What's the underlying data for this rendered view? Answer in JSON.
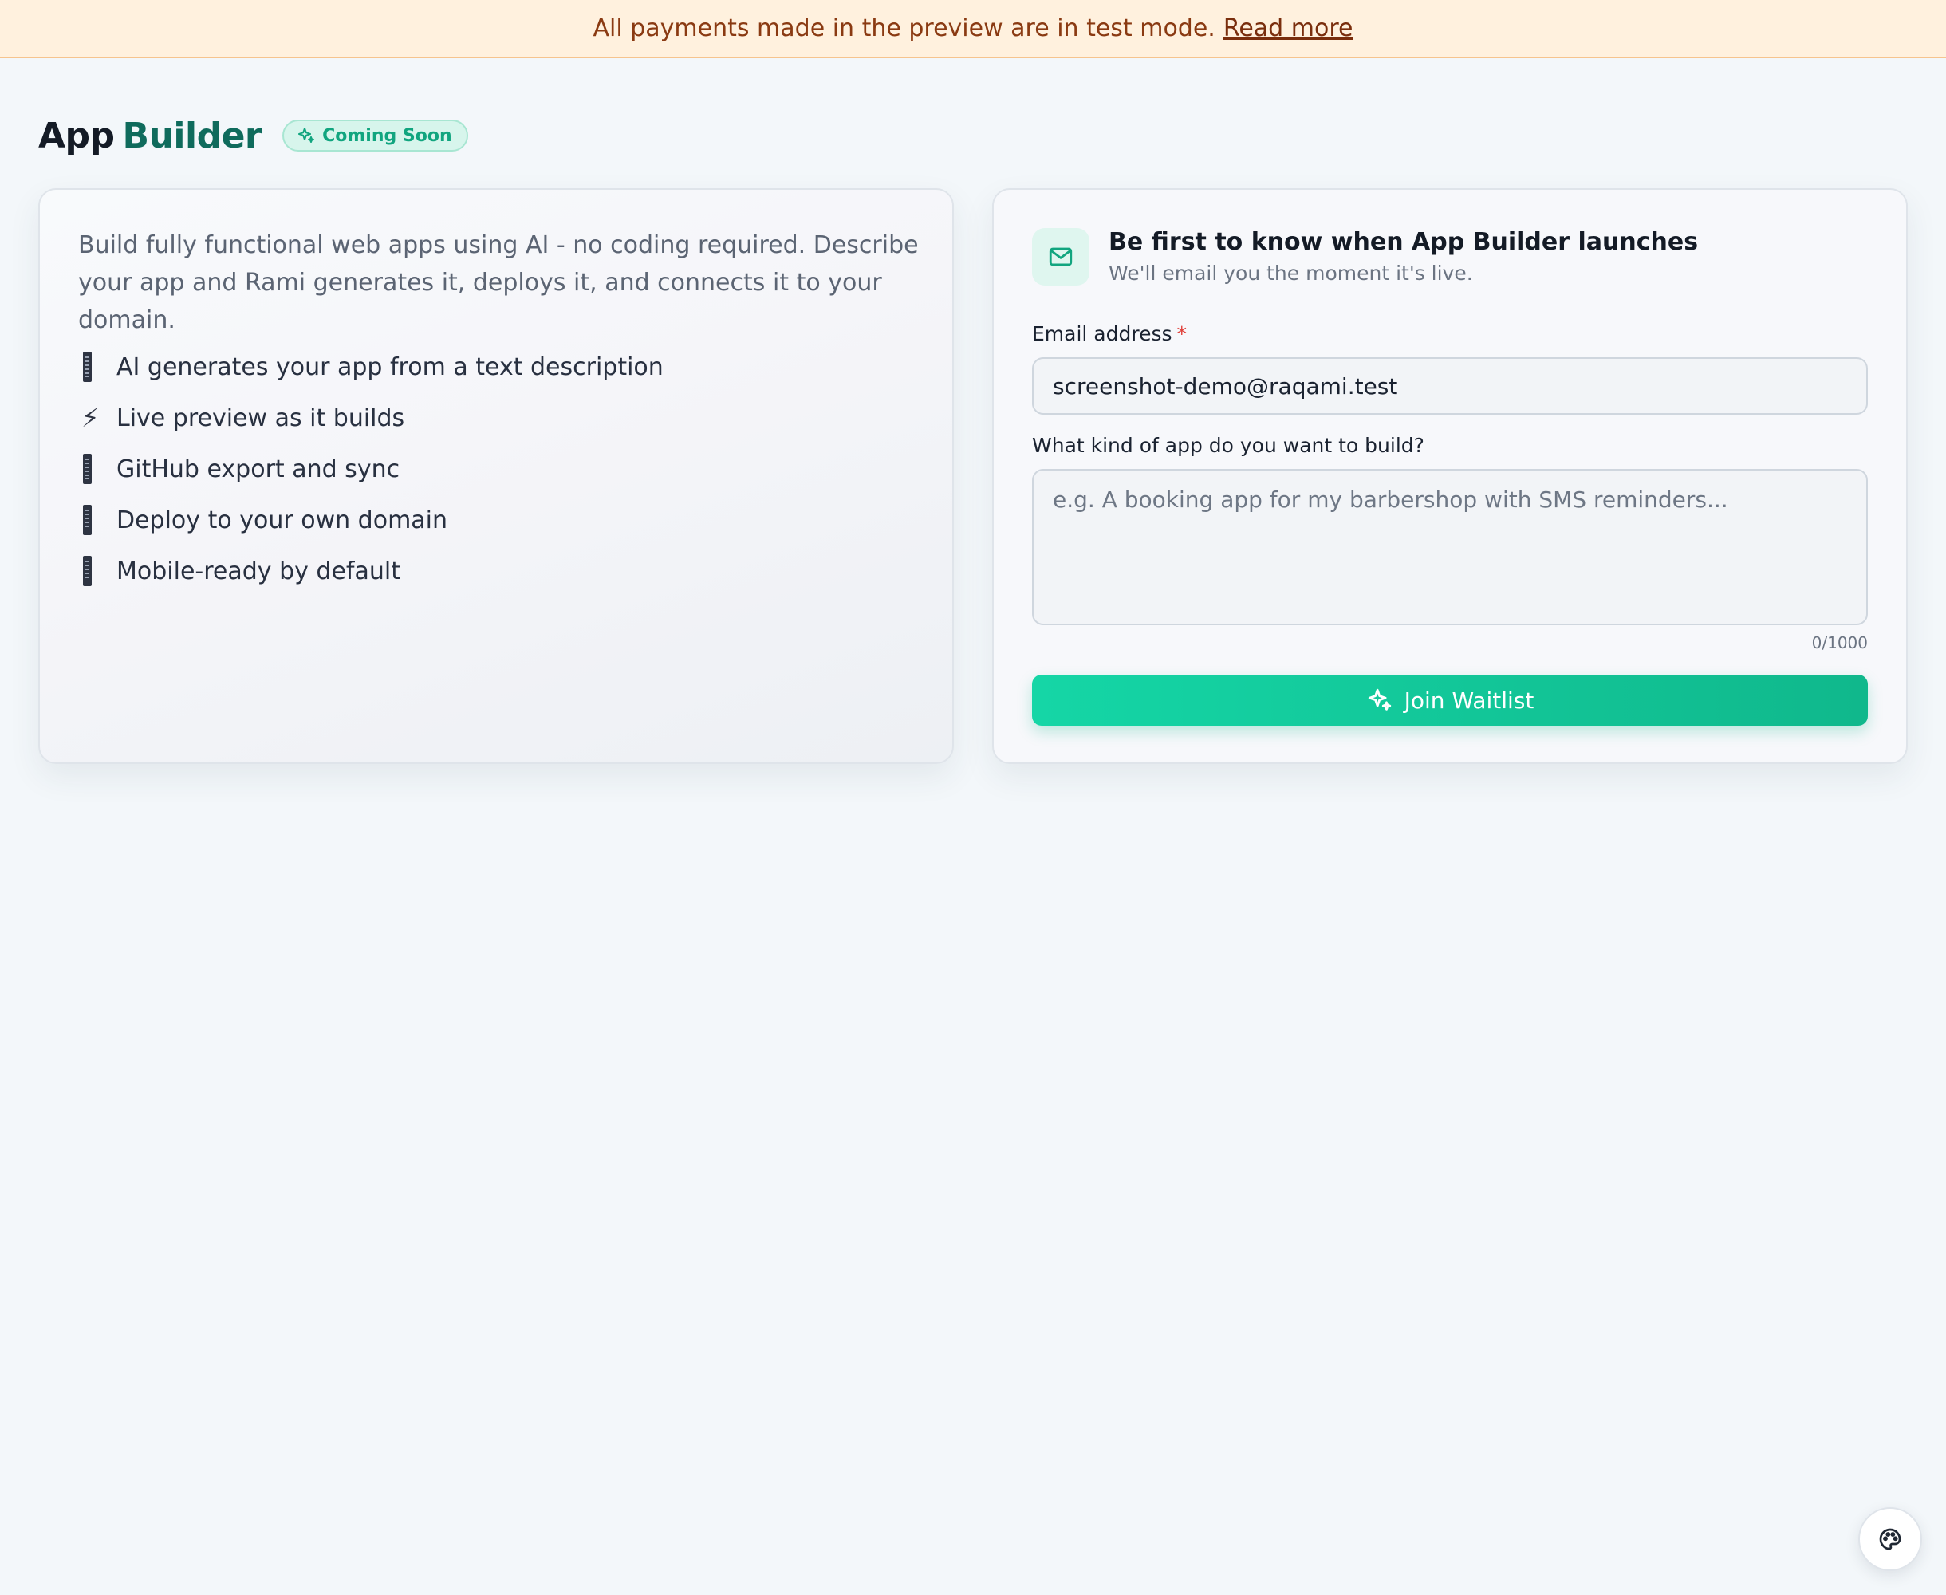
{
  "banner": {
    "text": "All payments made in the preview are in test mode.",
    "link": "Read more"
  },
  "header": {
    "title_part1": "App",
    "title_part2": "Builder",
    "badge": "Coming Soon",
    "badge_icon": "sparkle-icon"
  },
  "intro": {
    "description": "Build fully functional web apps using AI - no coding required. Describe your app and Rami generates it, deploys it, and connects it to your domain.",
    "features": [
      {
        "icon": "phone-glyph-icon",
        "label": "AI generates your app from a text description"
      },
      {
        "icon": "lightning-icon",
        "label": "Live preview as it builds"
      },
      {
        "icon": "phone-glyph-icon",
        "label": "GitHub export and sync"
      },
      {
        "icon": "phone-glyph-icon",
        "label": "Deploy to your own domain"
      },
      {
        "icon": "phone-glyph-icon",
        "label": "Mobile-ready by default"
      }
    ]
  },
  "waitlist": {
    "icon": "mail-icon",
    "title": "Be first to know when App Builder launches",
    "subtitle": "We'll email you the moment it's live.",
    "email_label": "Email address",
    "required_mark": "*",
    "email_value": "screenshot-demo@raqami.test",
    "app_label": "What kind of app do you want to build?",
    "app_placeholder": "e.g. A booking app for my barbershop with SMS reminders...",
    "counter": "0/1000",
    "submit_label": "Join Waitlist"
  },
  "floating": {
    "icon": "palette-icon"
  },
  "colors": {
    "accent": "#10b88c",
    "accent_light": "#15d6a6",
    "title_accent": "#0f6b5c",
    "banner_bg": "#fff1de",
    "banner_text": "#8a3a12"
  }
}
